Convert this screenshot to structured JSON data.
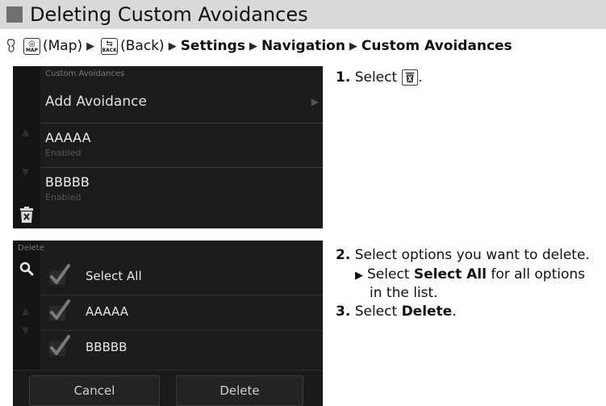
{
  "section": {
    "title": "Deleting Custom Avoidances"
  },
  "breadcrumb": {
    "map_key": {
      "icon": "map-icon",
      "sub": "MAP"
    },
    "map_text": "(Map)",
    "back_key": {
      "icon": "back-icon",
      "sub": "BACK"
    },
    "back_text": "(Back)",
    "settings": "Settings",
    "navigation": "Navigation",
    "custom_avoidances": "Custom Avoidances"
  },
  "screen1": {
    "header": "Custom Avoidances",
    "add_avoidance": "Add Avoidance",
    "items": [
      {
        "name": "AAAAA",
        "status": "Enabled"
      },
      {
        "name": "BBBBB",
        "status": "Enabled"
      }
    ]
  },
  "screen2": {
    "header": "Delete",
    "select_all": "Select All",
    "items": [
      "AAAAA",
      "BBBBB"
    ],
    "cancel": "Cancel",
    "delete": "Delete"
  },
  "steps": {
    "s1_num": "1.",
    "s1_text": "Select",
    "s1_end": ".",
    "s2_num": "2.",
    "s2_text": "Select options you want to delete.",
    "s2_sub_pre": "Select",
    "s2_sub_bold": "Select All",
    "s2_sub_post": "for all options",
    "s2_sub_line2": "in the list.",
    "s3_num": "3.",
    "s3_pre": "Select",
    "s3_bold": "Delete",
    "s3_end": "."
  }
}
